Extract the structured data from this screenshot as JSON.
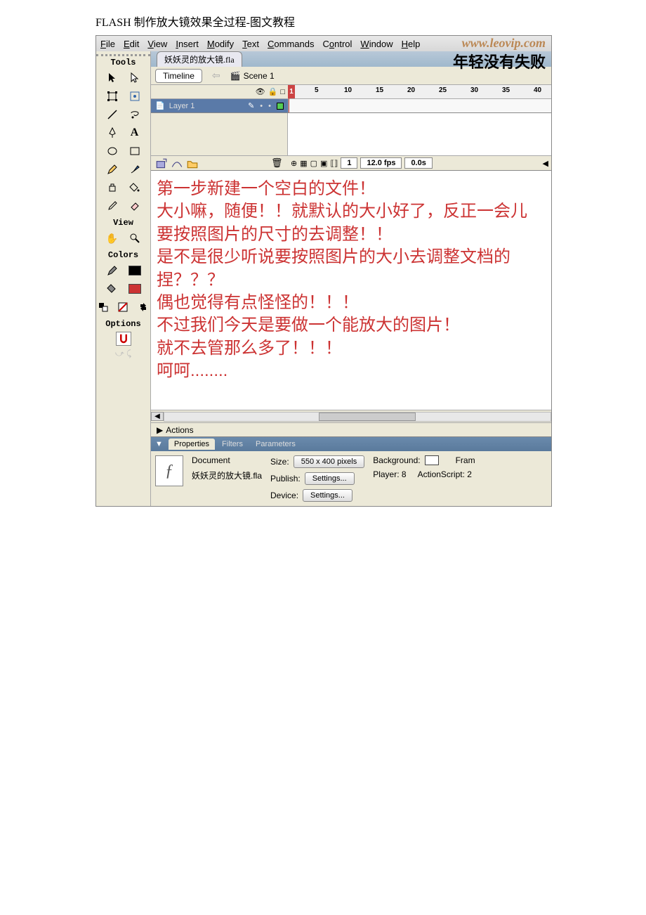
{
  "doc_title": "FLASH 制作放大镜效果全过程-图文教程",
  "menu": {
    "file": "File",
    "edit": "Edit",
    "view": "View",
    "insert": "Insert",
    "modify": "Modify",
    "text": "Text",
    "commands": "Commands",
    "control": "Control",
    "window": "Window",
    "help": "Help"
  },
  "watermark": "www.leovip.com",
  "banner": "年轻没有失败",
  "tools_header": "Tools",
  "view_header": "View",
  "colors_header": "Colors",
  "options_header": "Options",
  "file_tab": "妖妖灵的放大镜.fla",
  "timeline_btn": "Timeline",
  "scene_label": "Scene 1",
  "ruler": {
    "f1": "1",
    "f5": "5",
    "f10": "10",
    "f15": "15",
    "f20": "20",
    "f25": "25",
    "f30": "30",
    "f35": "35",
    "f40": "40"
  },
  "layer_name": "Layer 1",
  "tl_status": {
    "frame": "1",
    "fps": "12.0 fps",
    "time": "0.0s"
  },
  "stage_lines": [
    "第一步新建一个空白的文件！",
    "大小嘛，随便！！就默认的大小好了，反正一会儿",
    "要按照图片的尺寸的去调整！！",
    "是不是很少听说要按照图片的大小去调整文档的",
    "捏？？？",
    "偶也觉得有点怪怪的！！！",
    "不过我们今天是要做一个能放大的图片！",
    "就不去管那么多了！！！",
    "呵呵........"
  ],
  "actions_label": "Actions",
  "props_tabs": {
    "p": "Properties",
    "f": "Filters",
    "pa": "Parameters"
  },
  "props": {
    "doc_label": "Document",
    "doc_name": "妖妖灵的放大镜.fla",
    "size_label": "Size:",
    "size_val": "550 x 400 pixels",
    "bg_label": "Background:",
    "frame_label": "Fram",
    "publish_label": "Publish:",
    "settings": "Settings...",
    "player_label": "Player: 8",
    "as_label": "ActionScript: 2",
    "device_label": "Device:"
  }
}
